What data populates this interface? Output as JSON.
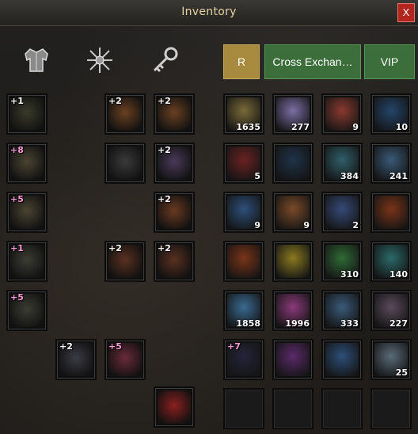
{
  "window": {
    "title": "Inventory",
    "close_label": "X"
  },
  "tabs": [
    {
      "icon": "armor-icon"
    },
    {
      "icon": "snowflake-icon"
    },
    {
      "icon": "key-icon"
    }
  ],
  "buttons": {
    "r": "R",
    "cross": "Cross Exchan…",
    "vip": "VIP"
  },
  "equipment": [
    {
      "name": "helmet-slot",
      "enh": "+1",
      "color": "#3a3a2a"
    },
    {
      "name": "earring-slot-1",
      "enh": "+2",
      "color": "#6a4020"
    },
    {
      "name": "earring-slot-2",
      "enh": "+2",
      "color": "#6a4020"
    },
    {
      "name": "chest-armor-slot",
      "enh": "+8",
      "color": "#4a4432"
    },
    {
      "name": "shield-slot",
      "enh": "",
      "color": "#3a3a3a"
    },
    {
      "name": "necklace-slot",
      "enh": "+2",
      "color": "#4a3a5a"
    },
    {
      "name": "gloves-slot",
      "enh": "+5",
      "color": "#4a4432"
    },
    {
      "name": "belt-slot",
      "enh": "+2",
      "color": "#6a3a20"
    },
    {
      "name": "pants-slot",
      "enh": "+1",
      "color": "#3c3c34"
    },
    {
      "name": "ring-slot-1",
      "enh": "+2",
      "color": "#5a3020"
    },
    {
      "name": "ring-slot-2",
      "enh": "+2",
      "color": "#5a3020"
    },
    {
      "name": "boots-slot",
      "enh": "+5",
      "color": "#3c3c34"
    },
    {
      "name": "weapon-slot",
      "enh": "+2",
      "color": "#3a3a44"
    },
    {
      "name": "costume-slot",
      "enh": "+5",
      "color": "#6a2a3a"
    },
    {
      "name": "pet-slot",
      "enh": "",
      "color": "#8a1f1f"
    }
  ],
  "bag": {
    "items": [
      {
        "name": "sheriff-badge",
        "count": "1635",
        "color": "#7a6a3a"
      },
      {
        "name": "violet-orb",
        "count": "277",
        "color": "#7b6fa5"
      },
      {
        "name": "red-scroll",
        "count": "9",
        "color": "#8a3a30"
      },
      {
        "name": "blue-crystal-wand",
        "count": "10",
        "color": "#24456a"
      },
      {
        "name": "red-potion",
        "count": "5",
        "color": "#6a2222"
      },
      {
        "name": "dark-helm",
        "count": "",
        "color": "#1f3348"
      },
      {
        "name": "gem-bag",
        "count": "384",
        "color": "#2f5f6a"
      },
      {
        "name": "ruby-pouch",
        "count": "241",
        "color": "#3a5a78"
      },
      {
        "name": "blue-scroll",
        "count": "9",
        "color": "#2d4f7a"
      },
      {
        "name": "bone-scroll",
        "count": "9",
        "color": "#7a4a28"
      },
      {
        "name": "wooden-club",
        "count": "2",
        "color": "#364a78"
      },
      {
        "name": "fire-claw",
        "count": "",
        "color": "#7a3418"
      },
      {
        "name": "flame-fist",
        "count": "",
        "color": "#7a3418"
      },
      {
        "name": "gold-infinity-coin",
        "count": "",
        "color": "#8a7a20"
      },
      {
        "name": "green-swirl",
        "count": "310",
        "color": "#2f6a36"
      },
      {
        "name": "teal-swirl",
        "count": "140",
        "color": "#2a6a68"
      },
      {
        "name": "blue-potions",
        "count": "1858",
        "color": "#3a6a90"
      },
      {
        "name": "pink-potions",
        "count": "1996",
        "color": "#8a3a7a"
      },
      {
        "name": "cyan-map",
        "count": "333",
        "color": "#3a5a7a"
      },
      {
        "name": "red-map",
        "count": "227",
        "color": "#5a4a5a"
      },
      {
        "name": "hooded-cloak",
        "count": "",
        "color": "#24243a"
      },
      {
        "name": "pink-horn",
        "count": "",
        "color": "#5a2a6a"
      },
      {
        "name": "blue-scroll-map",
        "count": "",
        "color": "#2d4f78"
      },
      {
        "name": "white-clouds",
        "count": "25",
        "color": "#5a6a78"
      },
      {
        "name": "empty-slot-1",
        "count": "",
        "color": ""
      },
      {
        "name": "empty-slot-2",
        "count": "",
        "color": ""
      },
      {
        "name": "empty-slot-3",
        "count": "",
        "color": ""
      },
      {
        "name": "empty-slot-4",
        "count": "",
        "color": ""
      }
    ],
    "enhancement_label": "+7"
  }
}
